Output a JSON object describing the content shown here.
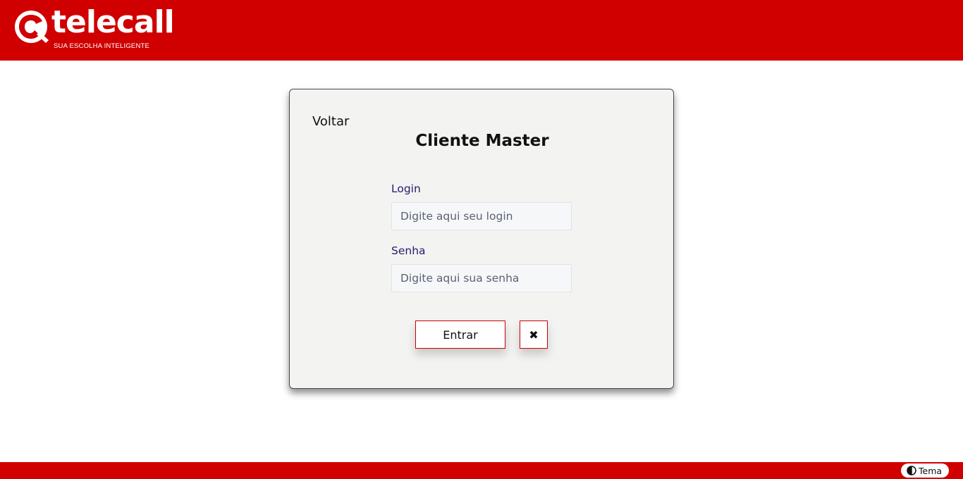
{
  "brand": {
    "name": "telecall",
    "tagline": "SUA ESCOLHA INTELIGENTE",
    "primary_color": "#d10000"
  },
  "login_card": {
    "back_label": "Voltar",
    "title": "Cliente Master",
    "login": {
      "label": "Login",
      "placeholder": "Digite aqui seu login",
      "value": ""
    },
    "password": {
      "label": "Senha",
      "placeholder": "Digite aqui sua senha",
      "value": ""
    },
    "submit_label": "Entrar",
    "close_label": "✖"
  },
  "footer": {
    "theme_label": "Tema",
    "theme_icon": "contrast-icon"
  }
}
